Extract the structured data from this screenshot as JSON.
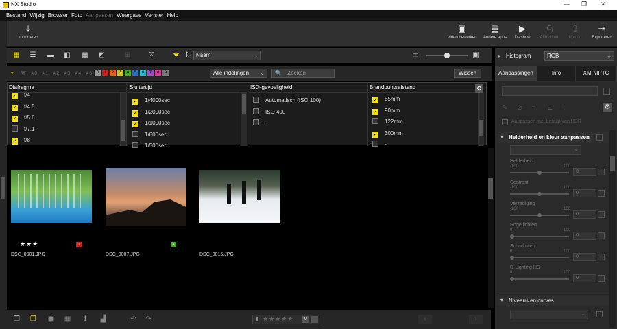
{
  "window": {
    "title": "NX Studio"
  },
  "menu": [
    "Bestand",
    "Wijzig",
    "Browser",
    "Foto",
    "Aanpassen",
    "Weergave",
    "Venster",
    "Help"
  ],
  "toolbar": {
    "import": "Importeren",
    "video_edit": "Video bewerken",
    "other_apps": "Andere apps",
    "slideshow": "Diashow",
    "print": "Afdrukken",
    "upload": "Upload",
    "export": "Exporteren"
  },
  "viewbar": {
    "sort_value": "Naam"
  },
  "filterbar": {
    "ratings": [
      "★0",
      "★1",
      "★2",
      "★3",
      "★4",
      "★5"
    ],
    "labels": [
      "0",
      "1",
      "2",
      "3",
      "4",
      "5",
      "6",
      "7",
      "8",
      "9"
    ],
    "label_colors": [
      "#999999",
      "#d11f1f",
      "#e0601a",
      "#d0c200",
      "#4aa52e",
      "#2b6fd0",
      "#2bb7c9",
      "#9b4dc4",
      "#cc3b8f",
      "#777777"
    ],
    "layout_select": "Alle indelingen",
    "search_placeholder": "Zoeken",
    "clear_button": "Wissen"
  },
  "filters": {
    "aperture": {
      "title": "Diafragma",
      "items": [
        {
          "label": "f/4",
          "checked": true
        },
        {
          "label": "f/4.5",
          "checked": true
        },
        {
          "label": "f/5.6",
          "checked": true
        },
        {
          "label": "f/7.1",
          "checked": false
        },
        {
          "label": "f/8",
          "checked": true
        }
      ]
    },
    "shutter": {
      "title": "Sluitertijd",
      "items": [
        {
          "label": "1/4000sec",
          "checked": true
        },
        {
          "label": "1/2000sec",
          "checked": true
        },
        {
          "label": "1/1000sec",
          "checked": true
        },
        {
          "label": "1/800sec",
          "checked": false
        },
        {
          "label": "1/500sec",
          "checked": false
        }
      ]
    },
    "iso": {
      "title": "ISO-gevoeligheid",
      "items": [
        {
          "label": "Automatisch (ISO 100)",
          "checked": false
        },
        {
          "label": "ISO 400",
          "checked": false
        },
        {
          "label": "-",
          "checked": false
        }
      ]
    },
    "focal": {
      "title": "Brandpuntsafstand",
      "items": [
        {
          "label": "85mm",
          "checked": true
        },
        {
          "label": "90mm",
          "checked": true
        },
        {
          "label": "122mm",
          "checked": false
        },
        {
          "label": "300mm",
          "checked": true
        },
        {
          "label": "-",
          "checked": false
        }
      ]
    }
  },
  "photos": [
    {
      "filename": "DSC_0001.JPG",
      "stars": "★★★",
      "label": "1",
      "label_color": "#d11f1f"
    },
    {
      "filename": "DSC_0007.JPG",
      "stars": "",
      "label": "4",
      "label_color": "#4aa52e"
    },
    {
      "filename": "DSC_0015.JPG",
      "stars": "",
      "label": "",
      "label_color": ""
    }
  ],
  "bottombar": {
    "rating_stars": "★★★★★",
    "rating_zero": "0"
  },
  "right_panel": {
    "histogram": "Histogram",
    "histogram_mode": "RGB",
    "tabs": [
      "Aanpassingen",
      "Info",
      "XMP/IPTC"
    ],
    "hdr_option": "Aanpassen met behulp van HDR",
    "section1": "Helderheid en kleur aanpassen",
    "section2": "Niveaus en curves",
    "sliders": [
      {
        "name": "Helderheid",
        "min": "-100",
        "max": "100",
        "value": "0"
      },
      {
        "name": "Contrast",
        "min": "-100",
        "max": "100",
        "value": "0"
      },
      {
        "name": "Verzadiging",
        "min": "-100",
        "max": "100",
        "value": "0"
      },
      {
        "name": "Hoge lichten",
        "min": "0",
        "max": "100",
        "value": "0"
      },
      {
        "name": "Schaduwen",
        "min": "0",
        "max": "100",
        "value": "0"
      },
      {
        "name": "D-Lighting HS",
        "min": "0",
        "max": "100",
        "value": "0"
      }
    ]
  }
}
